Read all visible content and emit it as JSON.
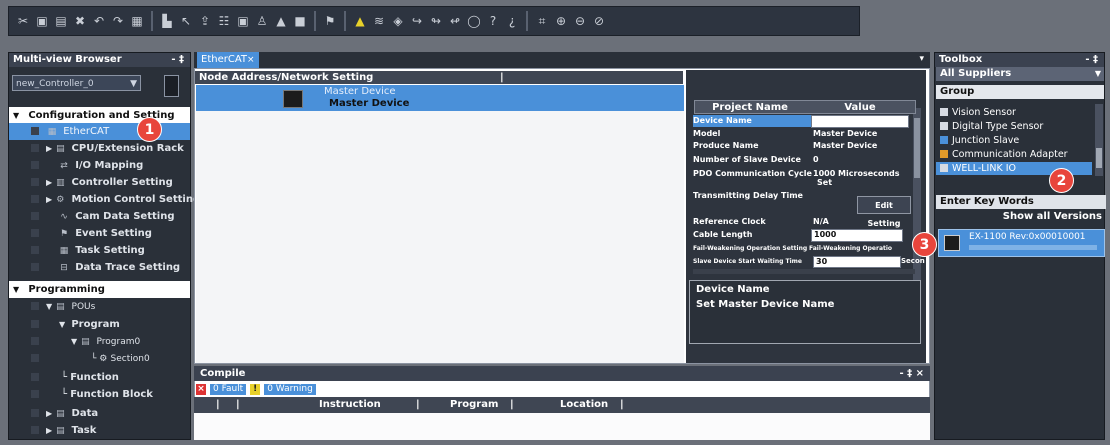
{
  "toolbar": {
    "icons": [
      "cut-icon",
      "copy-icon",
      "paste-icon",
      "delete-icon",
      "undo-icon",
      "redo-icon",
      "save-icon",
      "build-icon",
      "transfer-icon",
      "upload-icon",
      "compare-icon",
      "online-icon",
      "offline-icon",
      "monitor-icon",
      "warning-icon",
      "step-icon",
      "zoom-in-icon",
      "zoom-out-icon",
      "fit-icon"
    ]
  },
  "browser": {
    "title": "Multi-view Browser",
    "pin": "- ‡",
    "controller": "new_Controller_0",
    "items": [
      {
        "label": "Configuration and Setting",
        "level": 0,
        "kind": "header"
      },
      {
        "label": "EtherCAT",
        "level": 1,
        "kind": "selected"
      },
      {
        "label": "CPU/Extension Rack",
        "level": 1,
        "kind": "node"
      },
      {
        "label": "I/O Mapping",
        "level": 1,
        "kind": "leaf"
      },
      {
        "label": "Controller Setting",
        "level": 1,
        "kind": "node"
      },
      {
        "label": "Motion Control Setting",
        "level": 1,
        "kind": "node"
      },
      {
        "label": "Cam Data Setting",
        "level": 1,
        "kind": "leaf"
      },
      {
        "label": "Event Setting",
        "level": 1,
        "kind": "leaf"
      },
      {
        "label": "Task Setting",
        "level": 1,
        "kind": "leaf"
      },
      {
        "label": "Data Trace Setting",
        "level": 1,
        "kind": "leaf"
      },
      {
        "label": "Programming",
        "level": 0,
        "kind": "header"
      },
      {
        "label": "POUs",
        "level": 1,
        "kind": "node-open"
      },
      {
        "label": "Program",
        "level": 2,
        "kind": "node-open"
      },
      {
        "label": "Program0",
        "level": 3,
        "kind": "node-open"
      },
      {
        "label": "Section0",
        "level": 4,
        "kind": "leaf"
      },
      {
        "label": "Function",
        "level": 2,
        "kind": "leaf"
      },
      {
        "label": "Function Block",
        "level": 2,
        "kind": "leaf"
      },
      {
        "label": "Data",
        "level": 1,
        "kind": "node"
      },
      {
        "label": "Task",
        "level": 1,
        "kind": "node"
      }
    ]
  },
  "editor": {
    "tab": "EtherCAT",
    "node_header": "Node Address/Network Setting",
    "master_label_top": "Master Device",
    "master_label": "Master Device"
  },
  "props": {
    "col_name": "Project Name",
    "col_value": "Value",
    "rows": [
      {
        "name": "Device Name",
        "value": "",
        "input": true
      },
      {
        "name": "Model",
        "value": "Master Device"
      },
      {
        "name": "Produce Name",
        "value": "Master Device"
      },
      {
        "name": "Number of Slave Device",
        "value": "0"
      },
      {
        "name": "PDO Communication Cycle",
        "value": "1000   Microseconds",
        "extra": "Set"
      },
      {
        "name": "Transmitting Delay Time",
        "value": ""
      },
      {
        "name": "Reference Clock",
        "value": "N/A"
      },
      {
        "name": "Cable Length",
        "value": "1000",
        "input": true
      },
      {
        "name": "Fail-Weakening Operation Setting",
        "value": "Fail-Weakening Operatio"
      },
      {
        "name": "Slave Device Start Waiting Time",
        "value": "30",
        "input": true
      }
    ],
    "edit_button": "Edit Setting",
    "extra_side": "Secon",
    "desc_title": "Device Name",
    "desc_text": "Set Master Device Name"
  },
  "compile": {
    "title": "Compile",
    "pin": "- ‡ ×",
    "fault": "0 Fault",
    "warning": "0 Warning",
    "columns": [
      "Instruction",
      "Program",
      "Location"
    ]
  },
  "toolbox": {
    "title": "Toolbox",
    "pin": "- ‡",
    "supplier": "All Suppliers",
    "group_label": "Group",
    "groups": [
      "Vision Sensor",
      "Digital Type Sensor",
      "Junction Slave",
      "Communication Adapter",
      "WELL-LINK IO"
    ],
    "selected_group": "WELL-LINK IO",
    "keywords_label": "Enter Key Words",
    "show_all": "Show all Versions",
    "device": "EX-1100 Rev:0x00010001"
  },
  "callouts": [
    "1",
    "2",
    "3"
  ],
  "colors": {
    "accent": "#4a90d9",
    "callout": "#e8453c",
    "panel": "#2a3039"
  }
}
